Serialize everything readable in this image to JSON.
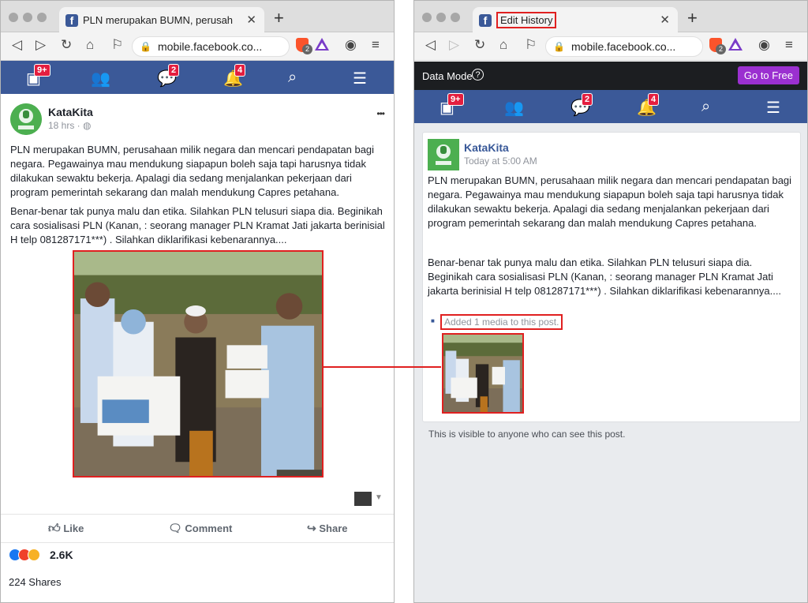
{
  "left": {
    "tab_title": "PLN merupakan BUMN, perusah",
    "url": "mobile.facebook.co...",
    "brave_count": "2",
    "badges": {
      "notifications_home": "9+",
      "messages": "2",
      "alerts": "4"
    },
    "post": {
      "author": "KataKita",
      "time": "18 hrs · ",
      "more": "•••",
      "para1": "PLN merupakan BUMN, perusahaan milik negara dan mencari pendapatan bagi negara. Pegawainya mau mendukung siapapun boleh saja tapi harusnya tidak dilakukan sewaktu bekerja. Apalagi dia sedang menjalankan pekerjaan dari program pemerintah sekarang dan malah mendukung Capres petahana.",
      "para2": "Benar-benar tak punya malu dan etika. Silahkan PLN telusuri siapa dia. Beginikah cara sosialisasi PLN (Kanan, : seorang manager PLN Kramat Jati jakarta berinisial H telp 081287171***) . Silahkan diklarifikasi kebenarannya....",
      "like": "Like",
      "comment": "Comment",
      "share": "Share",
      "reactions": "2.6K",
      "shares": "224 Shares"
    }
  },
  "right": {
    "tab_title": "Edit History",
    "url": "mobile.facebook.co...",
    "brave_count": "2",
    "data_mode": "Data Mode",
    "go_free": "Go to Free",
    "badges": {
      "notifications_home": "9+",
      "messages": "2",
      "alerts": "4"
    },
    "post": {
      "author": "KataKita",
      "time": "Today at 5:00 AM",
      "para1": "PLN merupakan BUMN, perusahaan milik negara dan mencari pendapatan bagi negara. Pegawainya mau mendukung siapapun boleh saja tapi harusnya tidak dilakukan sewaktu bekerja. Apalagi dia sedang menjalankan pekerjaan dari program pemerintah sekarang dan malah mendukung Capres petahana.",
      "para2": "Benar-benar tak punya malu dan etika. Silahkan PLN telusuri siapa dia. Beginikah cara sosialisasi PLN (Kanan, : seorang manager PLN Kramat Jati jakarta berinisial H telp 081287171***) . Silahkan diklarifikasi kebenarannya....",
      "edit_note": "Added 1 media to this post.",
      "visibility": "This is visible to anyone who can see this post."
    }
  },
  "colors": {
    "fb_blue": "#3b5998",
    "highlight": "#e02020",
    "go_free_purple": "#9b30d0",
    "badge_red": "#e41e3f"
  }
}
